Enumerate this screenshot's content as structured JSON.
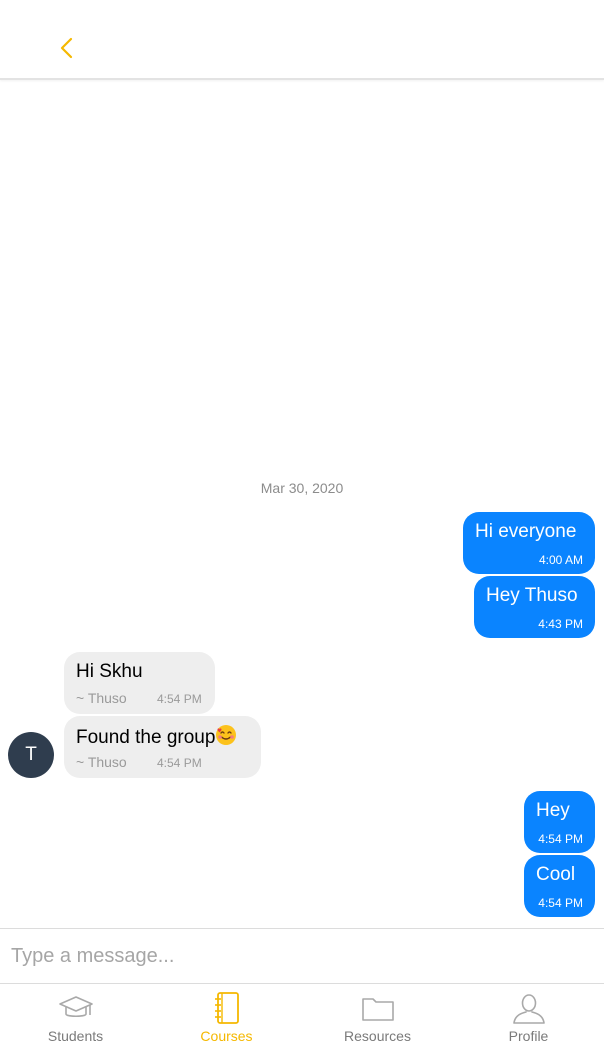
{
  "header": {
    "back_icon": "chevron-left-icon"
  },
  "colors": {
    "accent": "#f5b800",
    "outgoing_bubble": "#0a84ff",
    "incoming_bubble": "#eeeeee",
    "avatar_bg": "#2f3d4e",
    "inactive_tab": "#9a9a9a"
  },
  "chat": {
    "date_separator": "Mar 30, 2020",
    "messages": [
      {
        "direction": "outgoing",
        "text": "Hi everyone",
        "time": "4:00 AM"
      },
      {
        "direction": "outgoing",
        "text": "Hey Thuso",
        "time": "4:43 PM"
      },
      {
        "direction": "incoming",
        "text": "Hi Skhu",
        "sender": "~ Thuso",
        "time": "4:54 PM"
      },
      {
        "direction": "incoming",
        "text": "Found the group",
        "emoji": "smiling-face-with-hearts-icon",
        "sender": "~ Thuso",
        "time": "4:54 PM"
      },
      {
        "direction": "outgoing",
        "text": "Hey",
        "time": "4:54 PM"
      },
      {
        "direction": "outgoing",
        "text": "Cool",
        "time": "4:54 PM"
      }
    ],
    "avatar_initial": "T"
  },
  "composer": {
    "placeholder": "Type a message...",
    "value": ""
  },
  "tabs": [
    {
      "label": "Students",
      "icon": "graduation-cap-icon",
      "active": false
    },
    {
      "label": "Courses",
      "icon": "notebook-icon",
      "active": true
    },
    {
      "label": "Resources",
      "icon": "folder-icon",
      "active": false
    },
    {
      "label": "Profile",
      "icon": "user-icon",
      "active": false
    }
  ]
}
